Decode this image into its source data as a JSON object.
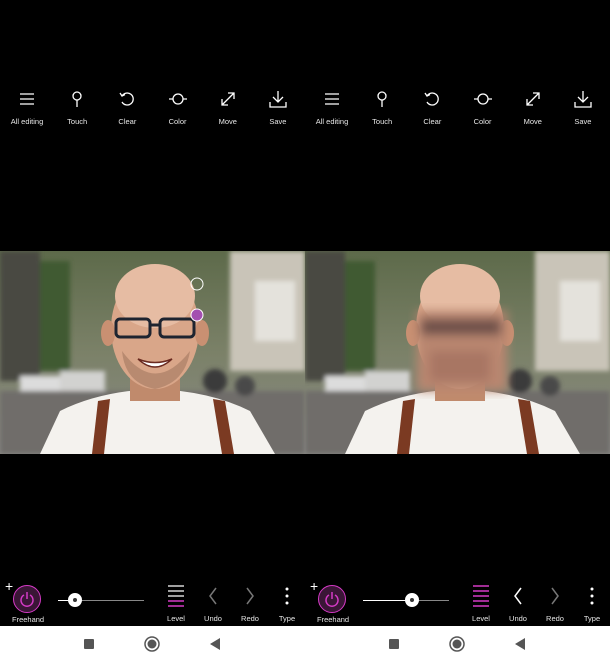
{
  "toolbar": {
    "items": [
      {
        "label": "All editing",
        "icon": "menu-icon"
      },
      {
        "label": "Touch",
        "icon": "touch-icon"
      },
      {
        "label": "Clear",
        "icon": "clear-icon"
      },
      {
        "label": "Color",
        "icon": "color-icon"
      },
      {
        "label": "Move",
        "icon": "move-icon"
      },
      {
        "label": "Save",
        "icon": "save-icon"
      }
    ]
  },
  "bottom": {
    "plus": "+",
    "freehand": "Freehand",
    "level": "Level",
    "undo": "Undo",
    "redo": "Redo",
    "type": "Type"
  },
  "panels": {
    "left": {
      "slider_value": 0.2
    },
    "right": {
      "slider_value": 0.57
    }
  },
  "colors": {
    "accent": "#d53ac6",
    "background": "#000000",
    "navbar": "#ffffff"
  }
}
